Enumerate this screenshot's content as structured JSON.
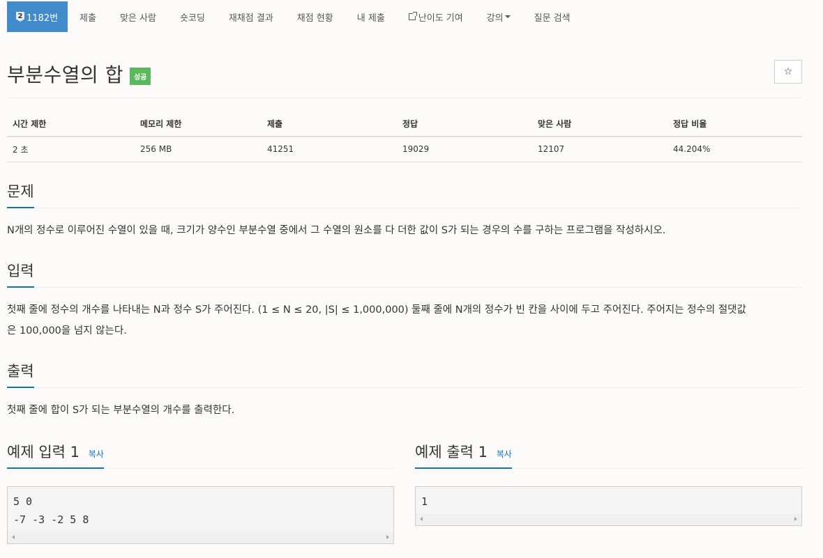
{
  "nav": {
    "problem_number": "1182번",
    "tier_digit": "2",
    "items": [
      "제출",
      "맞은 사람",
      "숏코딩",
      "재채점 결과",
      "채점 현황",
      "내 제출",
      "난이도 기여",
      "강의",
      "질문 검색"
    ]
  },
  "problem": {
    "title": "부분수열의 합",
    "badge": "성공",
    "star": "☆"
  },
  "info_table": {
    "headers": [
      "시간 제한",
      "메모리 제한",
      "제출",
      "정답",
      "맞은 사람",
      "정답 비율"
    ],
    "values": [
      "2 초",
      "256 MB",
      "41251",
      "19029",
      "12107",
      "44.204%"
    ]
  },
  "sections": {
    "problem": {
      "title": "문제",
      "text": "N개의 정수로 이루어진 수열이 있을 때, 크기가 양수인 부분수열 중에서 그 수열의 원소를 다 더한 값이 S가 되는 경우의 수를 구하는 프로그램을 작성하시오."
    },
    "input": {
      "title": "입력",
      "text_line1": "첫째 줄에 정수의 개수를 나타내는 N과 정수 S가 주어진다. (1 ≤ N ≤ 20, |S| ≤ 1,000,000) 둘째 줄에 N개의 정수가 빈 칸을 사이에 두고 주어진다. 주어지는 정수의 절댓값",
      "text_line2": "은 100,000을 넘지 않는다."
    },
    "output": {
      "title": "출력",
      "text": "첫째 줄에 합이 S가 되는 부분수열의 개수를 출력한다."
    }
  },
  "samples": {
    "input": {
      "title": "예제 입력 1",
      "copy": "복사",
      "lines": [
        "5 0",
        "-7 -3 -2 5 8"
      ]
    },
    "output": {
      "title": "예제 출력 1",
      "copy": "복사",
      "lines": [
        "1"
      ]
    }
  }
}
